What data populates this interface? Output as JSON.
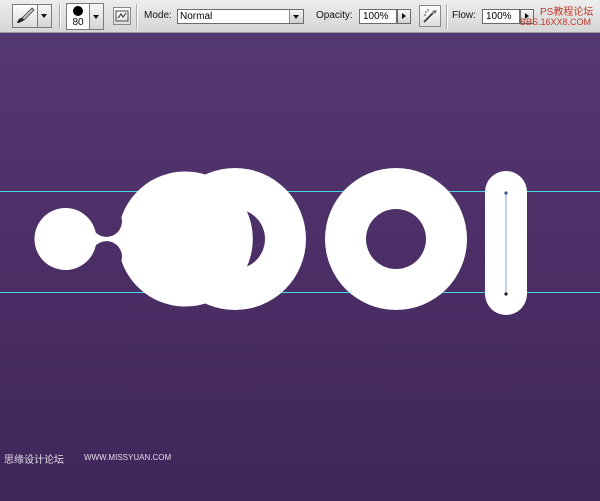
{
  "options_bar": {
    "tool_icon": "brush-icon",
    "brush_size": "80",
    "mode_label": "Mode:",
    "mode_value": "Normal",
    "opacity_label": "Opacity:",
    "opacity_value": "100%",
    "airbrush_icon": "airbrush-icon",
    "flow_label": "Flow:",
    "flow_value": "100%"
  },
  "canvas": {
    "background_top": "#553870",
    "background_bottom": "#40265a",
    "letter_color": "#ffffff",
    "guide_color": "#4ad7e6",
    "text": "COOl"
  },
  "watermarks": {
    "top_right": "PS教程论坛",
    "top_right_url": "BBS.16XX8.COM",
    "bottom_left": "思缘设计论坛",
    "bottom_left_url": "WWW.MISSYUAN.COM"
  }
}
